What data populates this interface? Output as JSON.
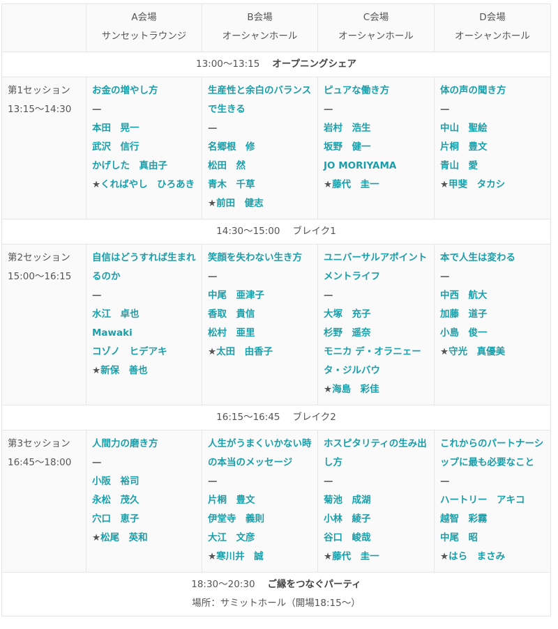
{
  "venues": [
    {
      "name": "A会場",
      "hall": "サンセットラウンジ"
    },
    {
      "name": "B会場",
      "hall": "オーシャンホール"
    },
    {
      "name": "C会場",
      "hall": "オーシャンホール"
    },
    {
      "name": "D会場",
      "hall": "オーシャンホール"
    }
  ],
  "colors": {
    "accent": "#1a9faa",
    "text": "#555555",
    "border": "#e5e5e5",
    "cell_bg": "#fafafa"
  },
  "opening": {
    "time": "13:00〜13:15",
    "title": "オープニングシェア"
  },
  "break1": {
    "time": "14:30〜15:00",
    "title": "ブレイク1"
  },
  "break2": {
    "time": "16:15〜16:45",
    "title": "ブレイク2"
  },
  "party": {
    "time": "18:30〜20:30",
    "title": "ご縁をつなぐパーティ",
    "place": "場所：サミットホール（開場18:15〜）"
  },
  "dash": "—",
  "star": "★",
  "sessions": [
    {
      "label": "第1セッション",
      "time": "13:15〜14:30",
      "talks": [
        {
          "title": "お金の増やし方",
          "speakers": [
            "本田　晃一",
            "武沢　信行",
            "かげした　真由子"
          ],
          "moderator": "くればやし　ひろあき"
        },
        {
          "title": "生産性と余白のバランスで生きる",
          "speakers": [
            "名郷根　修",
            "松田　然",
            "青木　千草"
          ],
          "moderator": "前田　健志"
        },
        {
          "title": "ピュアな働き方",
          "speakers": [
            "岩村　浩生",
            "坂野　健一",
            "JO MORIYAMA"
          ],
          "moderator": "藤代　圭一"
        },
        {
          "title": "体の声の聞き方",
          "speakers": [
            "中山　聖絵",
            "片桐　豊文",
            "青山　愛"
          ],
          "moderator": "甲斐　タカシ"
        }
      ]
    },
    {
      "label": "第2セッション",
      "time": "15:00〜16:15",
      "talks": [
        {
          "title": "自信はどうすれば生まれるのか",
          "speakers": [
            "水江　卓也",
            "Mawaki",
            "コゾノ　ヒデアキ"
          ],
          "moderator": "新保　善也"
        },
        {
          "title": "笑顔を失わない生き方",
          "speakers": [
            "中尾　亜津子",
            "香取　貴信",
            "松村　亜里"
          ],
          "moderator": "太田　由香子"
        },
        {
          "title": "ユニバーサルアポイントメントライフ",
          "speakers": [
            "大塚　充子",
            "杉野　遥奈",
            "モニカ デ・オラニェータ・ジルバウ"
          ],
          "moderator": "海島　彩佳"
        },
        {
          "title": "本で人生は変わる",
          "speakers": [
            "中西　航大",
            "加藤　道子",
            "小島　俊一"
          ],
          "moderator": "守光　真優美"
        }
      ]
    },
    {
      "label": "第3セッション",
      "time": "16:45〜18:00",
      "talks": [
        {
          "title": "人間力の磨き方",
          "speakers": [
            "小阪　裕司",
            "永松　茂久",
            "穴口　恵子"
          ],
          "moderator": "松尾　英和"
        },
        {
          "title": "人生がうまくいかない時の本当のメッセージ",
          "speakers": [
            "片桐　豊文",
            "伊堂寺　義則",
            "大江　文彦"
          ],
          "moderator": "寒川井　誠"
        },
        {
          "title": "ホスピタリティの生み出し方",
          "speakers": [
            "菊池　成湖",
            "小林　綾子",
            "谷口　峻哉"
          ],
          "moderator": "藤代　圭一"
        },
        {
          "title": "これからのパートナーシップに最も必要なこと",
          "speakers": [
            "ハートリー　アキコ",
            "越智　彩霧",
            "中尾　昭"
          ],
          "moderator": "はら　まさみ"
        }
      ]
    }
  ]
}
